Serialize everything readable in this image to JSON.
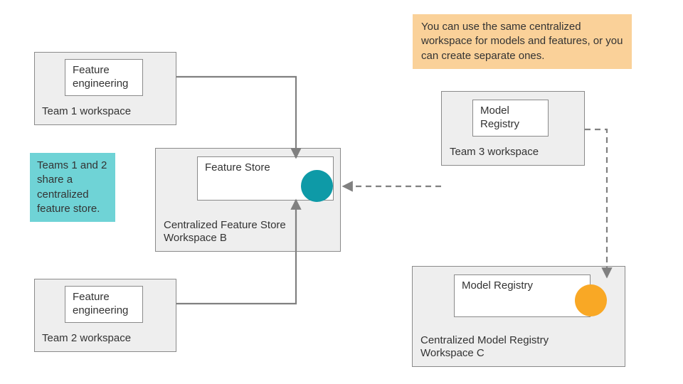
{
  "callouts": {
    "orange": "You can use the same centralized workspace for models and features, or you can create separate ones.",
    "teal": "Teams 1 and 2 share a centralized feature store."
  },
  "team1": {
    "workspace_label": "Team 1 workspace",
    "box_label": "Feature engineering"
  },
  "team2": {
    "workspace_label": "Team 2 workspace",
    "box_label": "Feature engineering"
  },
  "team3": {
    "workspace_label": "Team 3 workspace",
    "box_label": "Model Registry"
  },
  "feature_store": {
    "workspace_label": "Centralized Feature Store Workspace B",
    "box_label": "Feature Store"
  },
  "model_registry": {
    "workspace_label": "Centralized Model Registry Workspace C",
    "box_label": "Model Registry"
  },
  "colors": {
    "teal": "#0e9aa7",
    "orange": "#f9a825",
    "arrow": "#808080"
  }
}
